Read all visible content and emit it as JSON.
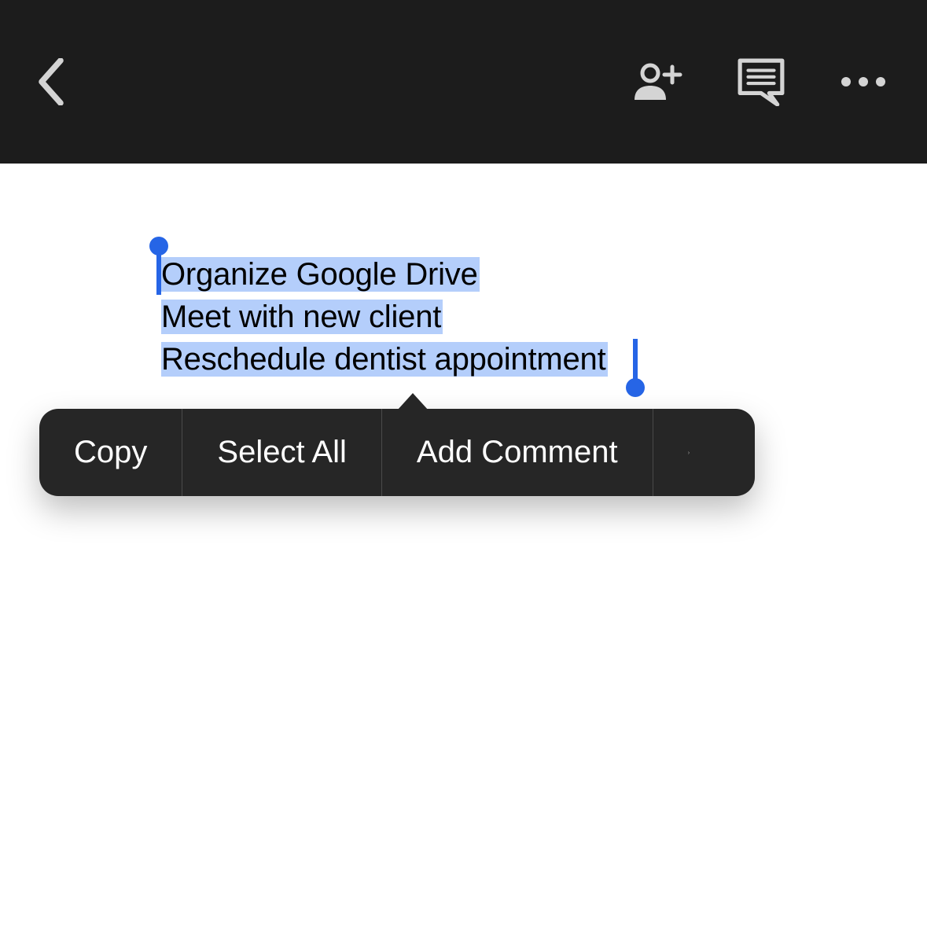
{
  "document": {
    "lines": [
      "Organize Google Drive",
      "Meet with new client",
      "Reschedule dentist appointment"
    ]
  },
  "context_menu": {
    "items": {
      "copy": "Copy",
      "select_all": "Select All",
      "add_comment": "Add Comment"
    }
  },
  "colors": {
    "selection": "#b4cefb",
    "handle": "#2665e6",
    "topbar": "#1c1c1c",
    "menu": "#262626"
  }
}
